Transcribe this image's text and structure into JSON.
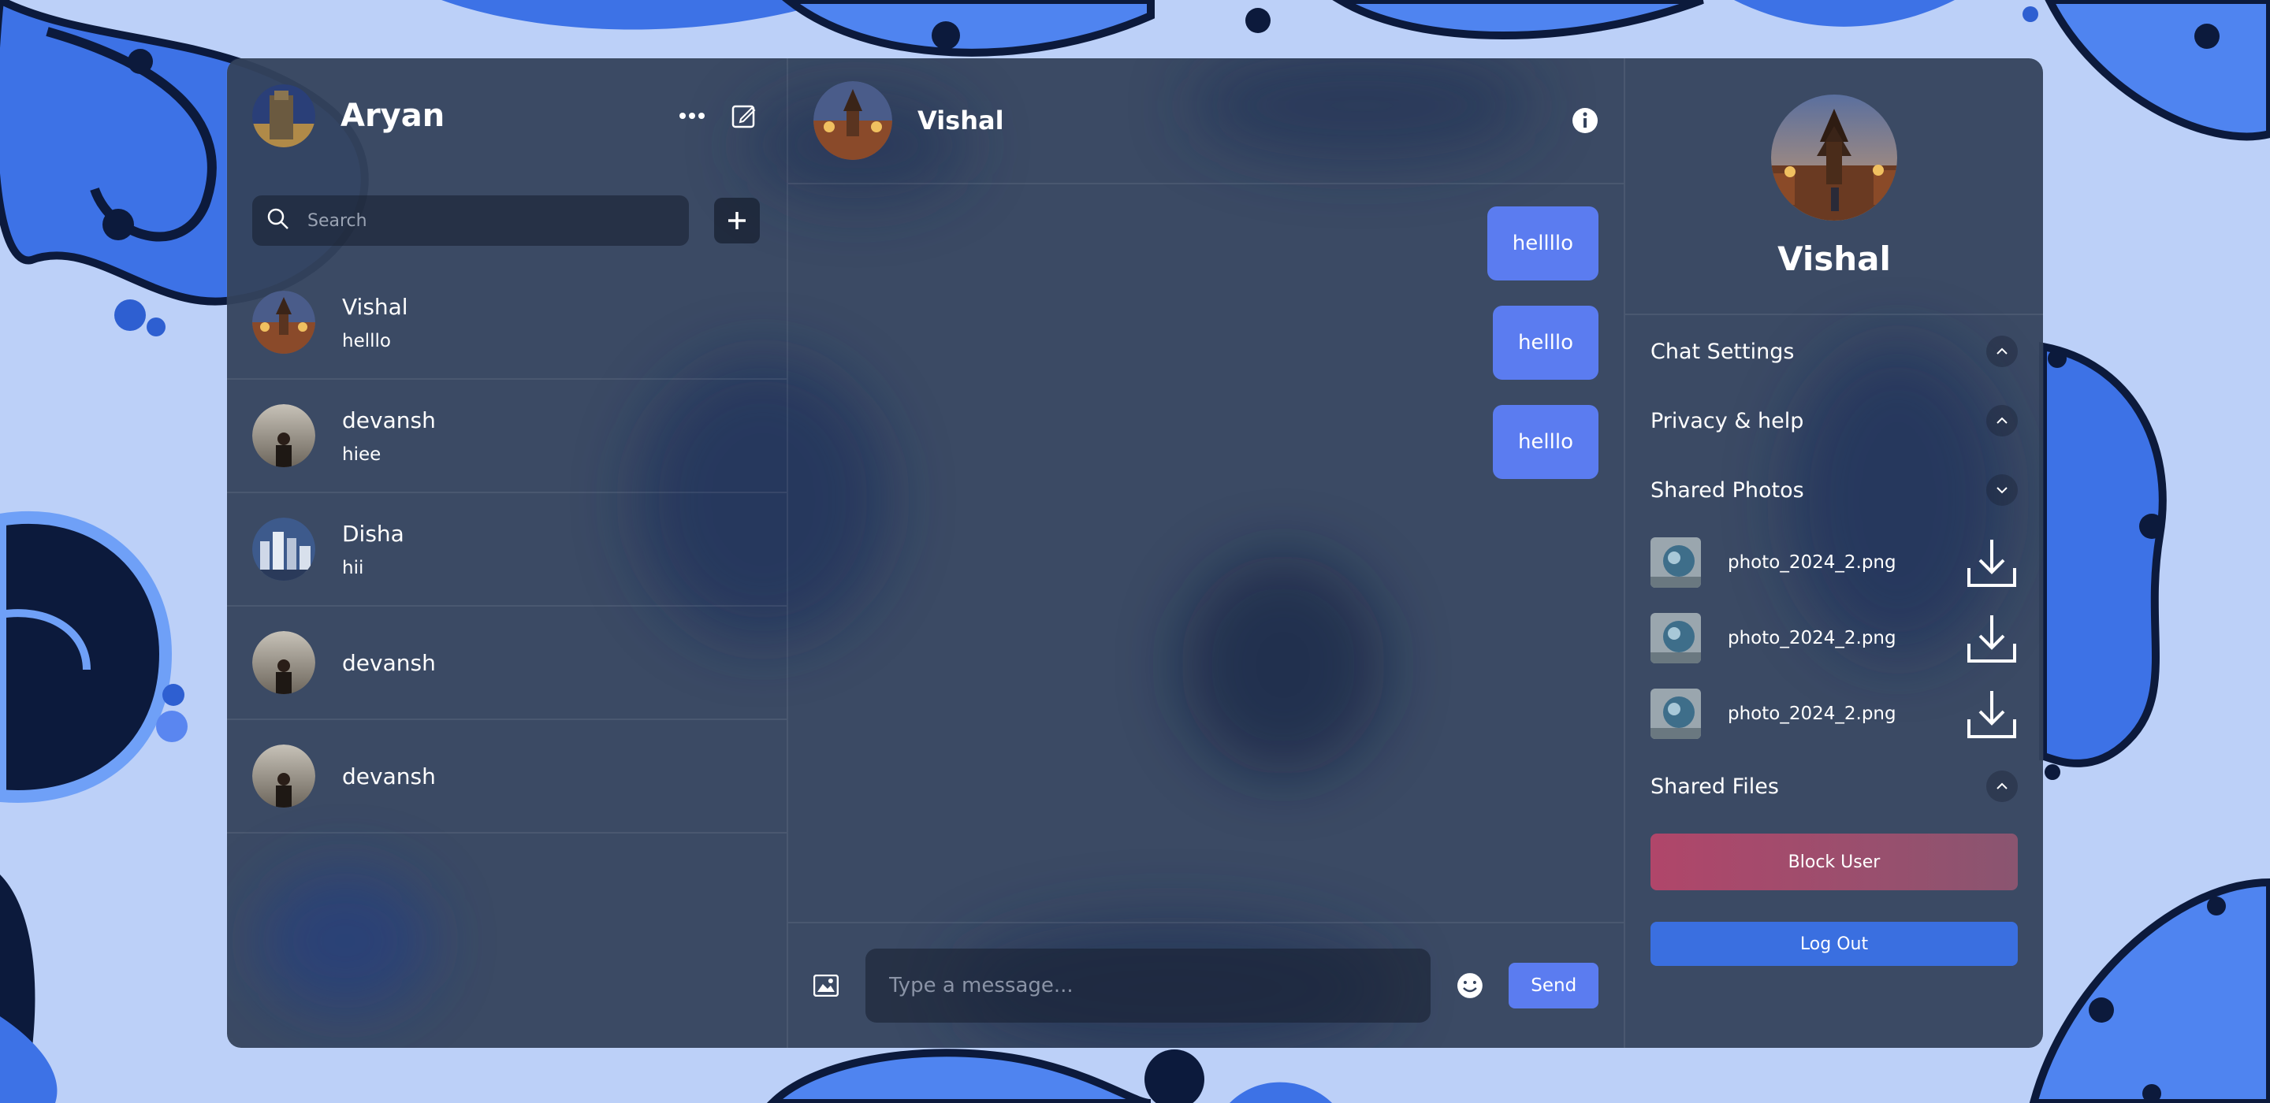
{
  "current_user": {
    "name": "Aryan"
  },
  "search": {
    "placeholder": "Search"
  },
  "chats": [
    {
      "name": "Vishal",
      "last_message": "helllo"
    },
    {
      "name": "devansh",
      "last_message": "hiee"
    },
    {
      "name": "Disha",
      "last_message": "hii"
    },
    {
      "name": "devansh",
      "last_message": ""
    },
    {
      "name": "devansh",
      "last_message": ""
    }
  ],
  "active_chat": {
    "name": "Vishal",
    "messages": [
      "hellllo",
      "helllo",
      "helllo"
    ]
  },
  "composer": {
    "placeholder": "Type a message...",
    "send_label": "Send"
  },
  "details": {
    "name": "Vishal",
    "sections": {
      "chat_settings": "Chat Settings",
      "privacy": "Privacy & help",
      "shared_photos": "Shared Photos",
      "shared_files": "Shared Files"
    },
    "photos": [
      "photo_2024_2.png",
      "photo_2024_2.png",
      "photo_2024_2.png"
    ],
    "block_label": "Block User",
    "logout_label": "Log Out"
  },
  "colors": {
    "accent": "#5b7cf0",
    "panel": "#34425c",
    "background": "#b9cdf7",
    "block": "#a04a6a",
    "logout": "#3a6fe0"
  },
  "icons": [
    "more-icon",
    "edit-icon",
    "search-icon",
    "plus-icon",
    "info-icon",
    "image-icon",
    "emoji-icon",
    "chevron-up-icon",
    "chevron-down-icon",
    "download-icon"
  ]
}
